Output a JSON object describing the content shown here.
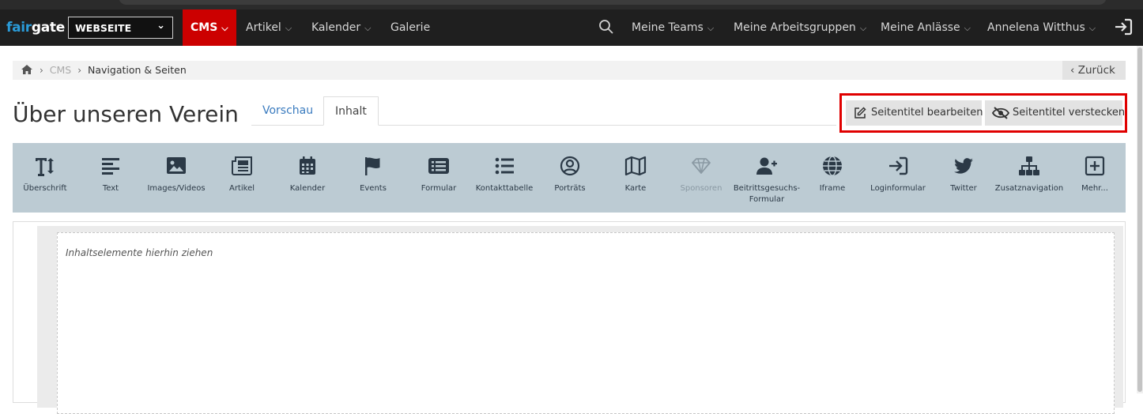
{
  "logo": {
    "part1": "fair",
    "part2": "gate"
  },
  "site_selector": {
    "value": "WEBSEITE"
  },
  "nav": {
    "cms": "CMS",
    "artikel": "Artikel",
    "kalender": "Kalender",
    "galerie": "Galerie",
    "teams": "Meine Teams",
    "arbeitsgruppen": "Meine Arbeitsgruppen",
    "anlaesse": "Meine Anlässe",
    "user": "Annelena Witthus"
  },
  "breadcrumb": {
    "cms": "CMS",
    "current": "Navigation & Seiten"
  },
  "back_label": "Zurück",
  "page_title": "Über unseren Verein",
  "tabs": {
    "preview": "Vorschau",
    "content": "Inhalt"
  },
  "title_actions": {
    "edit": "Seitentitel bearbeiten",
    "hide": "Seitentitel verstecken"
  },
  "toolbar": {
    "items": [
      {
        "label": "Überschrift",
        "icon": "text-height-icon"
      },
      {
        "label": "Text",
        "icon": "align-left-icon"
      },
      {
        "label": "Images/Videos",
        "icon": "image-icon"
      },
      {
        "label": "Artikel",
        "icon": "newspaper-icon"
      },
      {
        "label": "Kalender",
        "icon": "calendar-icon"
      },
      {
        "label": "Events",
        "icon": "flag-icon"
      },
      {
        "label": "Formular",
        "icon": "form-list-icon"
      },
      {
        "label": "Kontakttabelle",
        "icon": "list-icon"
      },
      {
        "label": "Porträts",
        "icon": "user-circle-icon"
      },
      {
        "label": "Karte",
        "icon": "map-icon"
      },
      {
        "label": "Sponsoren",
        "icon": "diamond-icon",
        "disabled": true
      },
      {
        "label": "Beitrittsgesuchs-Formular",
        "icon": "user-plus-icon"
      },
      {
        "label": "Iframe",
        "icon": "globe-icon"
      },
      {
        "label": "Loginformular",
        "icon": "sign-in-icon"
      },
      {
        "label": "Twitter",
        "icon": "twitter-icon"
      },
      {
        "label": "Zusatznavigation",
        "icon": "sitemap-icon"
      },
      {
        "label": "Mehr...",
        "icon": "plus-square-icon"
      }
    ]
  },
  "dropzone_hint": "Inhaltselemente hierhin ziehen",
  "colors": {
    "cms_active": "#cc0000",
    "toolbar_bg": "#bccbd3",
    "icon": "#2b3946",
    "link": "#3a7bbf",
    "highlight": "#e00000"
  }
}
